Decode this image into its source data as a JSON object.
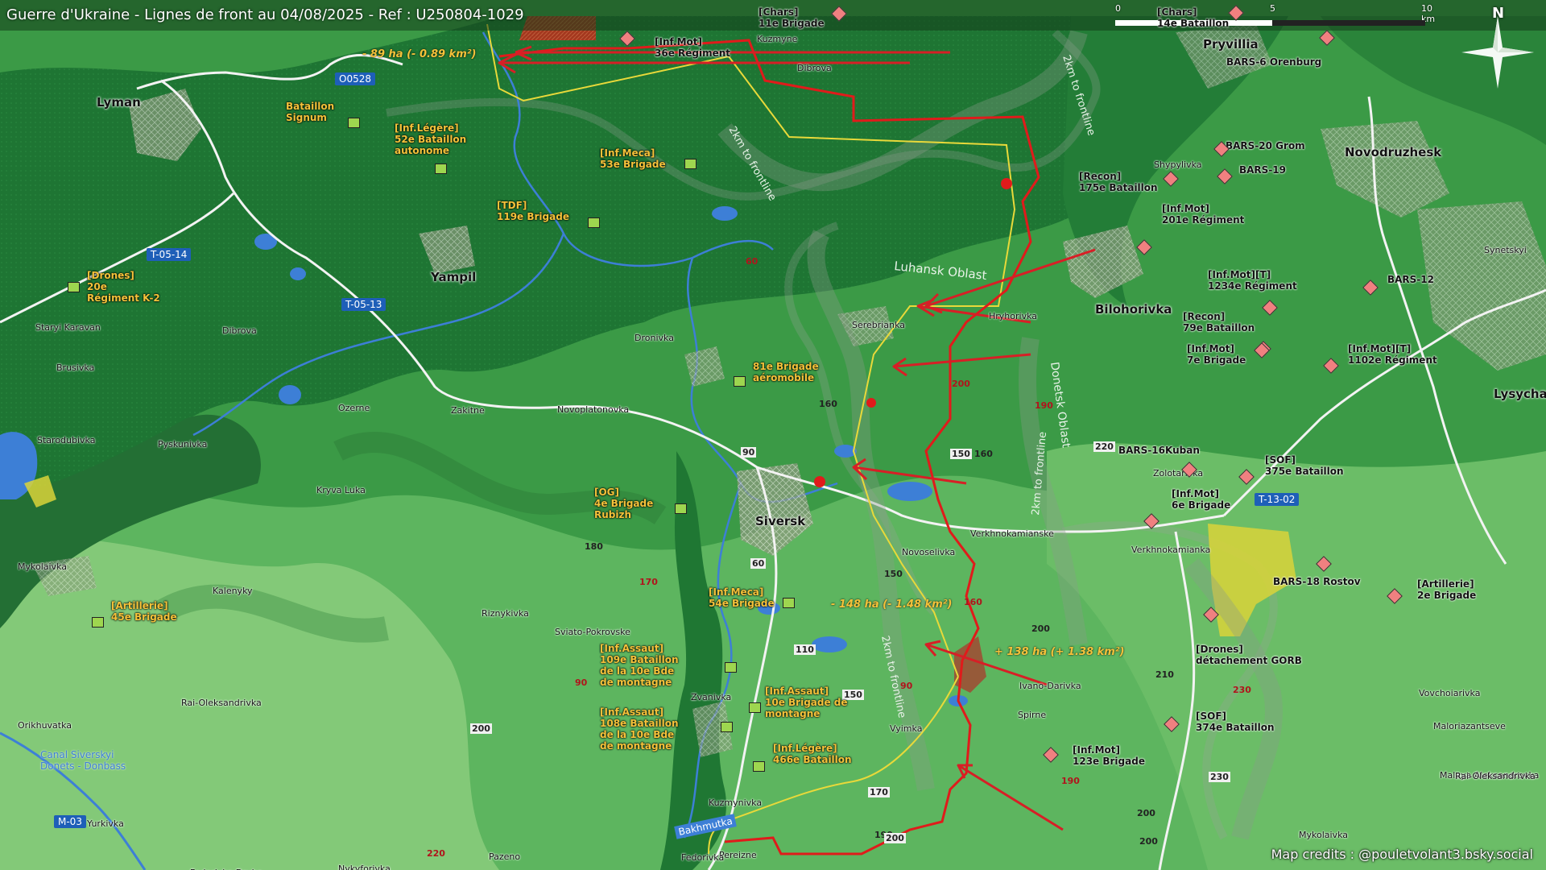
{
  "header": {
    "title": "Guerre d'Ukraine - Lignes de front au 04/08/2025 - Ref : U250804-1029"
  },
  "credits": "Map credits : @pouletvolant3.bsky.social",
  "scale": {
    "ticks": [
      "0",
      "5",
      "10 km"
    ]
  },
  "compass": {
    "label": "N"
  },
  "colors": {
    "forest": "#1f7a35",
    "field": "#3ea04a",
    "light_field": "#6cc06a",
    "water": "#3d7fd6",
    "russian": "#d71f26",
    "ukrainian": "#9ed64f",
    "front_line": "#e01b1b",
    "border_line": "#e8d93a",
    "road": "#f2f2f2",
    "label_orange": "#f5c23a"
  },
  "areas": [
    {
      "label": "- 89 ha (- 0.89 km²)",
      "type": "russian_gain"
    },
    {
      "label": "- 148 ha (- 1.48 km²)",
      "type": "russian_gain"
    },
    {
      "label": "+ 138 ha (+ 1.38 km²)",
      "type": "ukrainian_gain"
    }
  ],
  "cities": [
    "Lyman",
    "Yampil",
    "Siversk",
    "Bilohorivka",
    "Lysychansk",
    "Novodruzhesk",
    "Pryvillia"
  ],
  "towns": [
    "Kuzmyne",
    "Dibrova",
    "Starodubivka",
    "Pyskunivka",
    "Brusivka",
    "Staryi Karavan",
    "Dibrova",
    "Ozerne",
    "Zakitne",
    "Novoplatonovka",
    "Dronivka",
    "Serebrianka",
    "Hryhorivka",
    "Kryva Luka",
    "Mykolaivka",
    "Kalenyky",
    "Riznykivka",
    "Sviato-Pokrovske",
    "Zvanivka",
    "Kuzmynivka",
    "Pereizne",
    "Fedorivka",
    "Rai-Oleksandrivka",
    "Orikhuvatka",
    "Yurkivka",
    "Pazeno",
    "Fedorivka Druha",
    "Nykyforivka",
    "Novoselivka",
    "Verkhnokamianske",
    "Ivano-Darivka",
    "Vyimka",
    "Spirne",
    "Verkhnokamianka",
    "Zolotarivka",
    "Shypylivka",
    "Synetskyi",
    "Vovchoiarivka",
    "Maloriazantseve",
    "Malaya Aleksandrovka",
    "Rai-Oleksandrivka",
    "Mykolaivka"
  ],
  "regions": [
    "Luhansk Oblast",
    "Donetsk Oblast"
  ],
  "frontline_labels": [
    "2km to frontline",
    "2km to frontline",
    "2km to frontline",
    "2km to frontline"
  ],
  "road_signs": [
    "O0528",
    "T-05-14",
    "T-05-13",
    "T-13-02",
    "M-03"
  ],
  "canal": "Canal Siverskyi Donets - Donbass",
  "river": "Bakhmutka",
  "elevations": [
    "60",
    "90",
    "160",
    "200",
    "150",
    "160",
    "190",
    "220",
    "180",
    "170",
    "60",
    "150",
    "160",
    "110",
    "200",
    "90",
    "150",
    "210",
    "230",
    "230",
    "200",
    "190",
    "170",
    "190",
    "220",
    "200",
    "200",
    "90",
    "200"
  ],
  "ua_units": [
    {
      "lines": [
        "[Inf.Légère]",
        "52e Bataillon",
        "autonome"
      ]
    },
    {
      "lines": [
        "Bataillon",
        "Signum"
      ]
    },
    {
      "lines": [
        "[Inf.Meca]",
        "53e Brigade"
      ]
    },
    {
      "lines": [
        "[TDF]",
        "119e Brigade"
      ]
    },
    {
      "lines": [
        "[Drones]",
        "20e",
        "Régiment K-2"
      ]
    },
    {
      "lines": [
        "81e Brigade",
        "aéromobile"
      ]
    },
    {
      "lines": [
        "[OG]",
        "4e Brigade",
        "Rubizh"
      ]
    },
    {
      "lines": [
        "[Artillerie]",
        "45e Brigade"
      ]
    },
    {
      "lines": [
        "[Inf.Meca]",
        "54e Brigade"
      ]
    },
    {
      "lines": [
        "[Inf.Assaut]",
        "109e Bataillon",
        "de la 10e Bde",
        "de montagne"
      ]
    },
    {
      "lines": [
        "[Inf.Assaut]",
        "10e Brigade de",
        "montagne"
      ]
    },
    {
      "lines": [
        "[Inf.Assaut]",
        "108e Bataillon",
        "de la 10e Bde",
        "de montagne"
      ]
    },
    {
      "lines": [
        "[Inf.Légère]",
        "466e Bataillon"
      ]
    }
  ],
  "ru_units": [
    {
      "lines": [
        "[Chars]",
        "11e Brigade"
      ]
    },
    {
      "lines": [
        "[Inf.Mot]",
        "36e Régiment"
      ]
    },
    {
      "lines": [
        "[Chars]",
        "14e Bataillon"
      ]
    },
    {
      "lines": [
        "BARS-6 Orenburg"
      ]
    },
    {
      "lines": [
        "BARS-20 Grom"
      ]
    },
    {
      "lines": [
        "BARS-19"
      ]
    },
    {
      "lines": [
        "[Recon]",
        "175e Bataillon"
      ]
    },
    {
      "lines": [
        "[Inf.Mot]",
        "201e Régiment"
      ]
    },
    {
      "lines": [
        "[Inf.Mot][T]",
        "1234e Régiment"
      ]
    },
    {
      "lines": [
        "BARS-12"
      ]
    },
    {
      "lines": [
        "[Recon]",
        "79e Bataillon"
      ]
    },
    {
      "lines": [
        "[Inf.Mot]",
        "7e Brigade"
      ]
    },
    {
      "lines": [
        "[Inf.Mot][T]",
        "1102e Régiment"
      ]
    },
    {
      "lines": [
        "BARS-16Kuban"
      ]
    },
    {
      "lines": [
        "[SOF]",
        "375e Bataillon"
      ]
    },
    {
      "lines": [
        "[Inf.Mot]",
        "6e Brigade"
      ]
    },
    {
      "lines": [
        "BARS-18 Rostov"
      ]
    },
    {
      "lines": [
        "[Artillerie]",
        "2e Brigade"
      ]
    },
    {
      "lines": [
        "[Drones]",
        "détachement GORB"
      ]
    },
    {
      "lines": [
        "[SOF]",
        "374e Bataillon"
      ]
    },
    {
      "lines": [
        "[Inf.Mot]",
        "123e Brigade"
      ]
    }
  ]
}
